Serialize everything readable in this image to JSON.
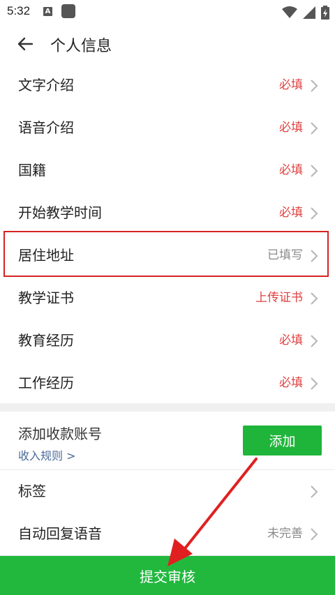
{
  "status_bar": {
    "time": "5:32",
    "a_badge": "A"
  },
  "app_bar": {
    "title": "个人信息",
    "back_icon": "arrow-left-icon"
  },
  "rows": [
    {
      "label": "文字介绍",
      "value": "必填",
      "value_color": "#e04040"
    },
    {
      "label": "语音介绍",
      "value": "必填",
      "value_color": "#e04040"
    },
    {
      "label": "国籍",
      "value": "必填",
      "value_color": "#e04040"
    },
    {
      "label": "开始教学时间",
      "value": "必填",
      "value_color": "#e04040"
    },
    {
      "label": "居住地址",
      "value": "已填写",
      "value_color": "#8a8a8a"
    },
    {
      "label": "教学证书",
      "value": "上传证书",
      "value_color": "#e04040"
    },
    {
      "label": "教育经历",
      "value": "必填",
      "value_color": "#e04040"
    },
    {
      "label": "工作经历",
      "value": "必填",
      "value_color": "#e04040"
    }
  ],
  "account": {
    "label": "添加收款账号",
    "rule_link": "收入规则 >",
    "add_button": "添加"
  },
  "tags_row": {
    "label": "标签",
    "value": ""
  },
  "auto_reply_row": {
    "label": "自动回复语音",
    "value": "未完善"
  },
  "submit_button": "提交审核",
  "colors": {
    "accent_green": "#22b83e",
    "required_red": "#e04040",
    "highlight_red": "#d32222"
  }
}
